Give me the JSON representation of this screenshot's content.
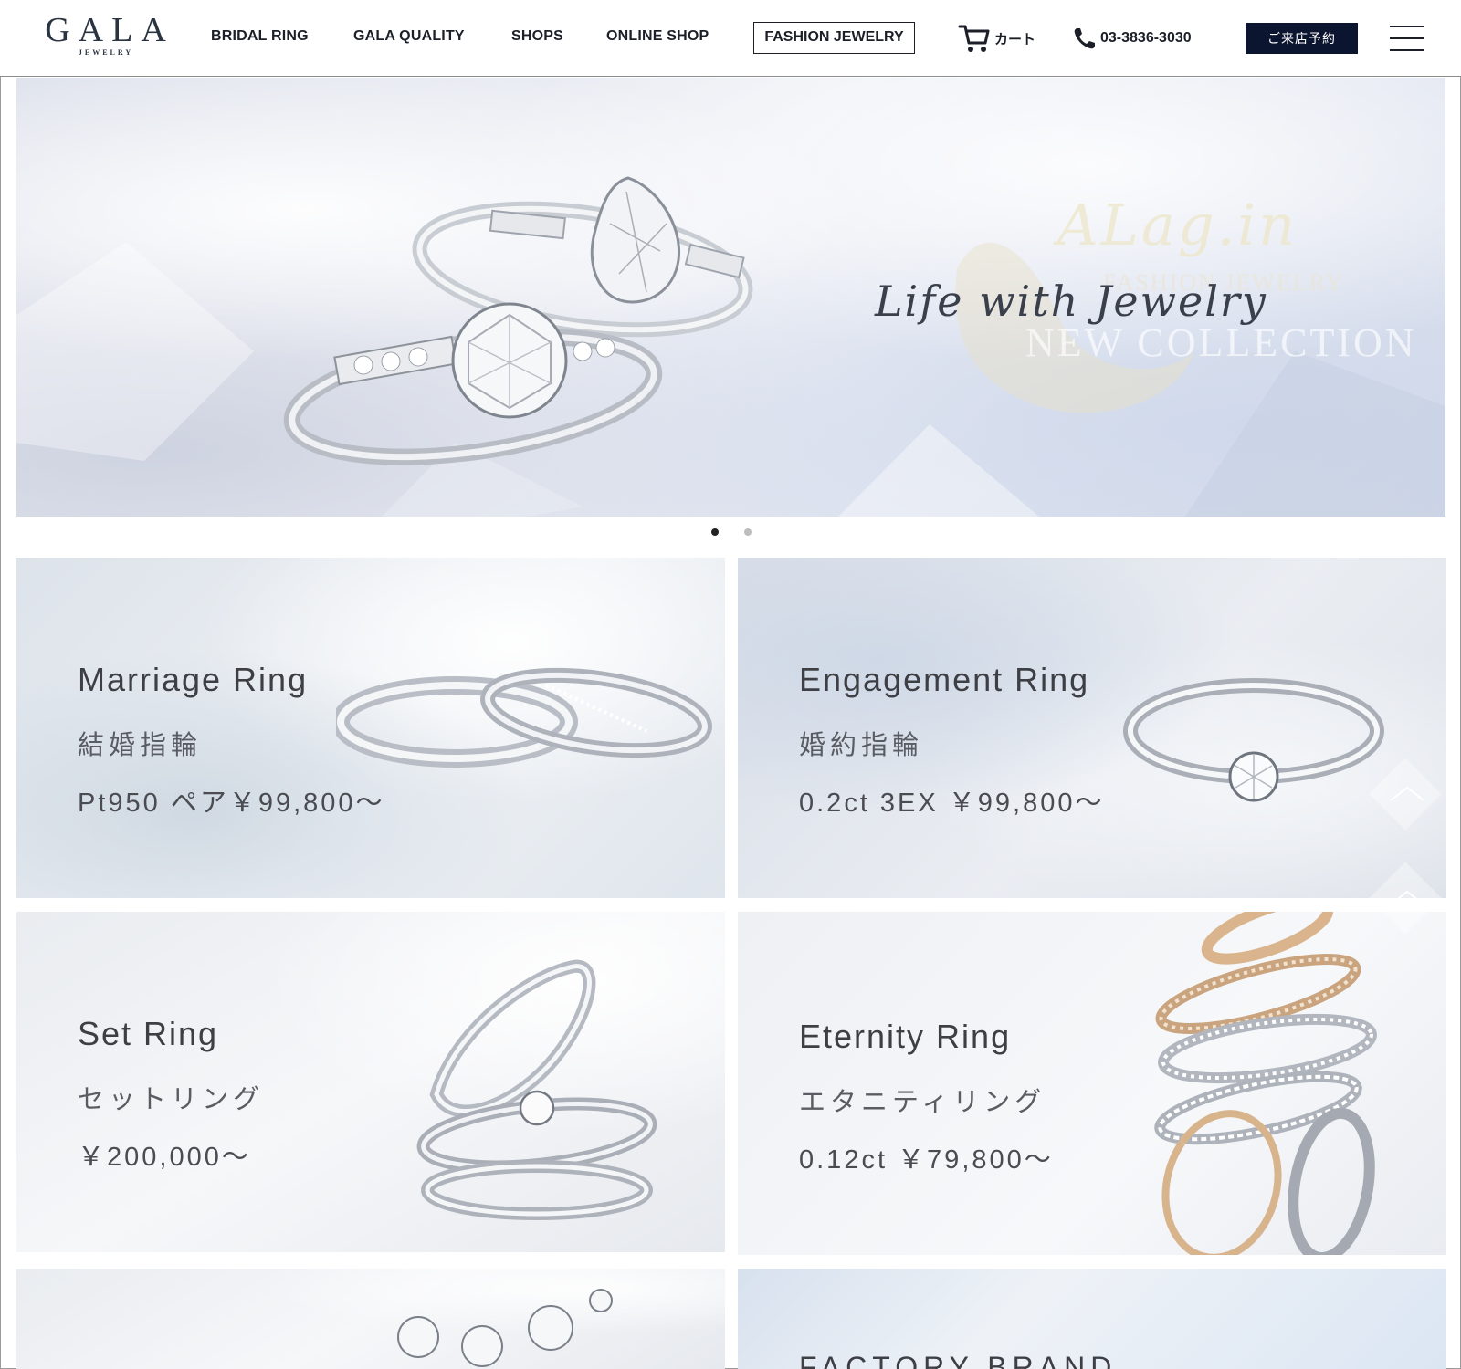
{
  "header": {
    "logo_main": "GALA",
    "logo_sub": "JEWELRY",
    "nav": [
      "BRIDAL RING",
      "GALA QUALITY",
      "SHOPS",
      "ONLINE SHOP"
    ],
    "fashion_label": "FASHION JEWELRY",
    "cart_label": "カート",
    "phone": "03-3836-3030",
    "reserve_label": "ご来店予約"
  },
  "hero": {
    "brand_script": "ALag.in",
    "sub1": "FASHION JEWELRY",
    "sub2": "NEW COLLECTION",
    "tagline": "Life with Jewelry",
    "slides": 2,
    "active_slide": 1
  },
  "tiles": [
    {
      "title": "Marriage Ring",
      "jp": "結婚指輪",
      "price": "Pt950 ペア￥99,800～"
    },
    {
      "title": "Engagement Ring",
      "jp": "婚約指輪",
      "price": "0.2ct 3EX ￥99,800～"
    },
    {
      "title": "Set Ring",
      "jp": "セットリング",
      "price": "￥200,000～"
    },
    {
      "title": "Eternity Ring",
      "jp": "エタニティリング",
      "price": "0.12ct ￥79,800～"
    }
  ],
  "factory": {
    "label": "FACTORY BRAND"
  },
  "colors": {
    "navy": "#0c1530",
    "text_dark": "#1c1f28",
    "tile_text": "#3d3f45"
  }
}
